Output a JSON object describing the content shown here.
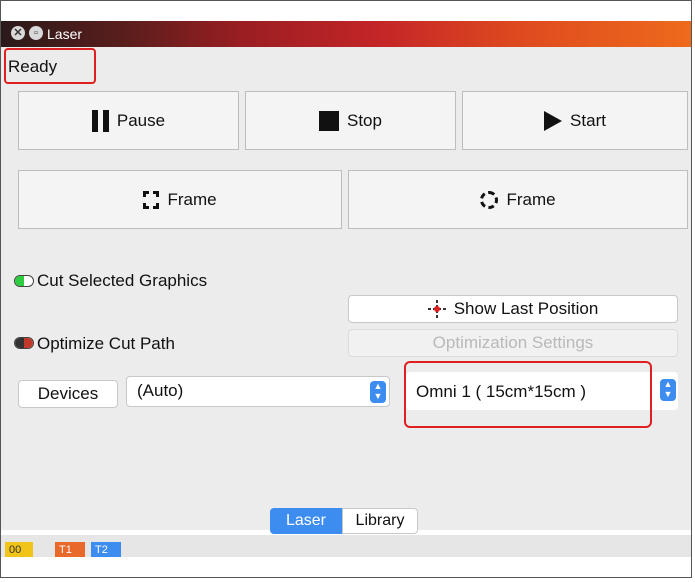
{
  "window": {
    "title": "Laser"
  },
  "status": {
    "text": "Ready"
  },
  "controls": {
    "pause": "Pause",
    "stop": "Stop",
    "start": "Start",
    "frame_rect": "Frame",
    "frame_circle": "Frame"
  },
  "options": {
    "cut_selected": {
      "label": "Cut Selected Graphics",
      "toggle_color": "#2ecc40"
    },
    "optimize": {
      "label": "Optimize Cut Path",
      "toggle_color": "#c0392b"
    },
    "show_last_position": "Show Last Position",
    "optimization_settings": "Optimization Settings"
  },
  "devices": {
    "button": "Devices",
    "port": "(Auto)",
    "model": "Omni 1 ( 15cm*15cm )"
  },
  "tabs": {
    "laser": "Laser",
    "library": "Library"
  },
  "bottom_chips": [
    {
      "label": "00",
      "color": "#f0c419"
    },
    {
      "label": "T1",
      "color": "#e8692a"
    },
    {
      "label": "T2",
      "color": "#3d8cf0"
    }
  ],
  "accent": "#3d8cf0",
  "highlight": "#e02020"
}
